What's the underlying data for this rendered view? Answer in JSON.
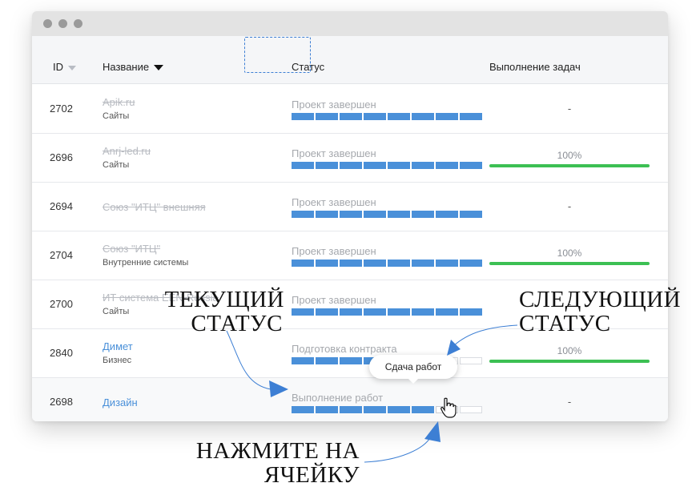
{
  "table": {
    "headers": {
      "id": "ID",
      "name": "Название",
      "status": "Статус",
      "progress": "Выполнение задач"
    },
    "rows": [
      {
        "id": "2702",
        "name": "Apik.ru",
        "sub": "Сайты",
        "name_style": "strike",
        "status": "Проект завершен",
        "status_filled": 8,
        "status_total": 8,
        "progress": "-"
      },
      {
        "id": "2696",
        "name": "Anrj-led.ru",
        "sub": "Сайты",
        "name_style": "strike",
        "status": "Проект завершен",
        "status_filled": 8,
        "status_total": 8,
        "progress": "100%"
      },
      {
        "id": "2694",
        "name": "Союз \"ИТЦ\" внешняя",
        "sub": "",
        "name_style": "strike",
        "status": "Проект завершен",
        "status_filled": 8,
        "status_total": 8,
        "progress": "-"
      },
      {
        "id": "2704",
        "name": "Союз \"ИТЦ\"",
        "sub": "Внутренние системы",
        "name_style": "strike",
        "status": "Проект завершен",
        "status_filled": 8,
        "status_total": 8,
        "progress": "100%"
      },
      {
        "id": "2700",
        "name": "ИТ система EEN-Russia",
        "sub": "Сайты",
        "name_style": "strike",
        "status": "Проект завершен",
        "status_filled": 8,
        "status_total": 8,
        "progress": "-"
      },
      {
        "id": "2840",
        "name": "Димет",
        "sub": "Бизнес",
        "name_style": "link",
        "status": "Подготовка контракта",
        "status_filled": 4,
        "status_total": 8,
        "progress": "100%"
      },
      {
        "id": "2698",
        "name": "Дизайн",
        "sub": "",
        "name_style": "link",
        "status": "Выполнение работ",
        "status_filled": 6,
        "status_total": 8,
        "progress": "-"
      }
    ]
  },
  "tooltip": {
    "text": "Сдача работ"
  },
  "annotations": {
    "current_status": [
      "ТЕКУЩИЙ",
      "СТАТУС"
    ],
    "next_status": [
      "СЛЕДУЮЩИЙ",
      "СТАТУС"
    ],
    "click_cell": [
      "НАЖМИТЕ НА",
      "ЯЧЕЙКУ"
    ]
  },
  "colors": {
    "accent_blue": "#4a90d9",
    "progress_green": "#3cc053",
    "window_dots": "#9a9a9a",
    "arrow_blue": "#3d7fd4"
  },
  "icons": [
    "sort-down-icon",
    "hand-pointer-icon",
    "window-dot-icon"
  ]
}
